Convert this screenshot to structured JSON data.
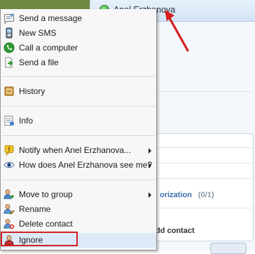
{
  "window": {
    "contact_name": "Anel Erzhanova",
    "authorization_label": "orization",
    "authorization_count": "(0/1)",
    "add_contact_label": "dd contact"
  },
  "menu": {
    "items": [
      {
        "label": "Send a message",
        "icon": "message-icon"
      },
      {
        "label": "New SMS",
        "icon": "sms-phone-icon"
      },
      {
        "label": "Call a computer",
        "icon": "call-icon"
      },
      {
        "label": "Send a file",
        "icon": "file-send-icon"
      },
      {
        "label": "History",
        "icon": "history-icon"
      },
      {
        "label": "Info",
        "icon": "info-icon"
      },
      {
        "label": "Notify when Anel Erzhanova...",
        "icon": "notify-icon",
        "submenu": true
      },
      {
        "label": "How does Anel Erzhanova see me?",
        "icon": "eye-icon",
        "submenu": true
      },
      {
        "label": "Move to group",
        "icon": "move-group-icon",
        "submenu": true
      },
      {
        "label": "Rename",
        "icon": "rename-icon"
      },
      {
        "label": "Delete contact",
        "icon": "delete-contact-icon"
      },
      {
        "label": "Ignore",
        "icon": "ignore-icon",
        "highlighted": true
      }
    ]
  },
  "colors": {
    "highlight_box": "#d42020",
    "pointer_arrow": "#d42020",
    "status_online": "#2f9b2c"
  }
}
